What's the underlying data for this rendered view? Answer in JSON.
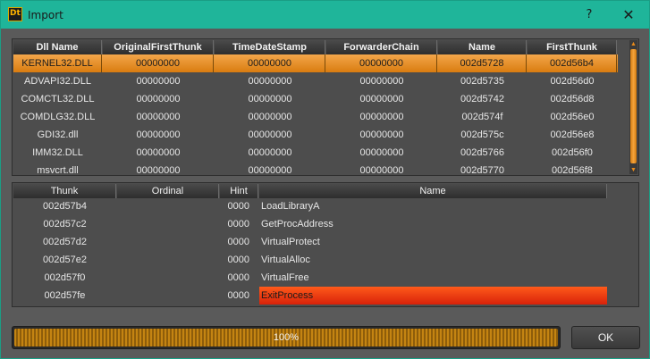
{
  "window": {
    "title": "Import",
    "icon_text": "Dt",
    "help_label": "?",
    "close_label": "✕"
  },
  "dll_table": {
    "columns": [
      "Dll Name",
      "OriginalFirstThunk",
      "TimeDateStamp",
      "ForwarderChain",
      "Name",
      "FirstThunk"
    ],
    "rows": [
      [
        "KERNEL32.DLL",
        "00000000",
        "00000000",
        "00000000",
        "002d5728",
        "002d56b4"
      ],
      [
        "ADVAPI32.DLL",
        "00000000",
        "00000000",
        "00000000",
        "002d5735",
        "002d56d0"
      ],
      [
        "COMCTL32.DLL",
        "00000000",
        "00000000",
        "00000000",
        "002d5742",
        "002d56d8"
      ],
      [
        "COMDLG32.DLL",
        "00000000",
        "00000000",
        "00000000",
        "002d574f",
        "002d56e0"
      ],
      [
        "GDI32.dll",
        "00000000",
        "00000000",
        "00000000",
        "002d575c",
        "002d56e8"
      ],
      [
        "IMM32.DLL",
        "00000000",
        "00000000",
        "00000000",
        "002d5766",
        "002d56f0"
      ],
      [
        "msvcrt.dll",
        "00000000",
        "00000000",
        "00000000",
        "002d5770",
        "002d56f8"
      ]
    ],
    "selected_index": 0
  },
  "thunk_table": {
    "columns": [
      "Thunk",
      "Ordinal",
      "Hint",
      "Name"
    ],
    "rows": [
      [
        "002d57b4",
        "",
        "0000",
        "LoadLibraryA"
      ],
      [
        "002d57c2",
        "",
        "0000",
        "GetProcAddress"
      ],
      [
        "002d57d2",
        "",
        "0000",
        "VirtualProtect"
      ],
      [
        "002d57e2",
        "",
        "0000",
        "VirtualAlloc"
      ],
      [
        "002d57f0",
        "",
        "0000",
        "VirtualFree"
      ],
      [
        "002d57fe",
        "",
        "0000",
        "ExitProcess"
      ]
    ],
    "selected_index": 5
  },
  "progress": {
    "label": "100%",
    "value": 1.0
  },
  "ok_label": "OK",
  "icons": {
    "app": "app-icon",
    "help": "help-icon",
    "close": "close-icon",
    "scroll_up": "scroll-up-arrow-icon",
    "scroll_down": "scroll-down-arrow-icon"
  },
  "colors": {
    "titlebar": "#1fb59a",
    "selection": "#e88a1a",
    "name_highlight": "#e8300f",
    "progress": "#c48412"
  }
}
